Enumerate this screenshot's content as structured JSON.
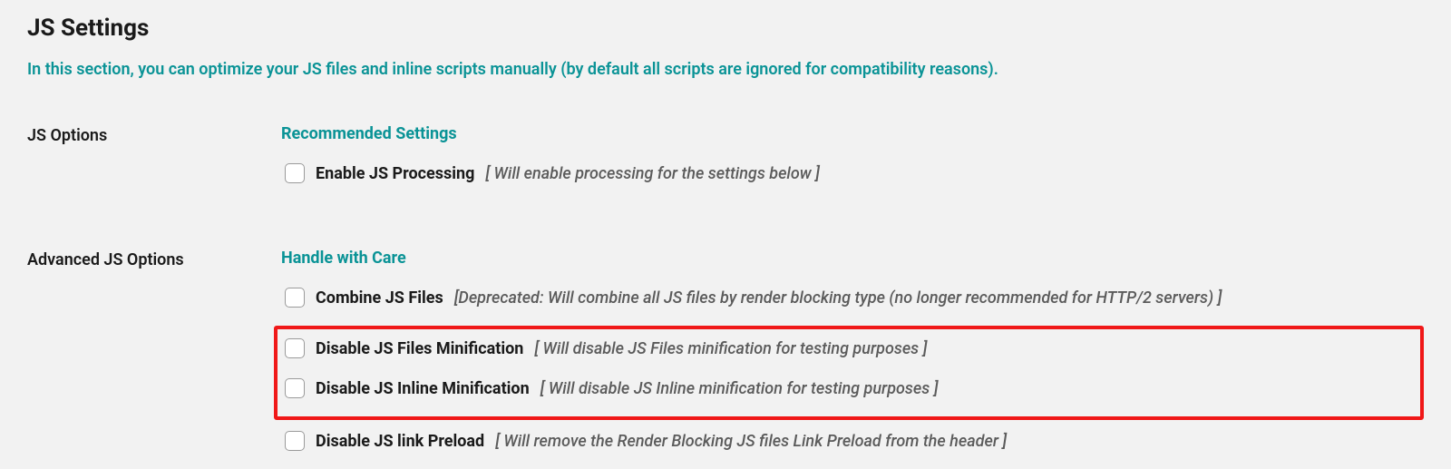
{
  "title": "JS Settings",
  "description": "In this section, you can optimize your JS files and inline scripts manually (by default all scripts are ignored for compatibility reasons).",
  "sections": [
    {
      "label": "JS Options",
      "subtitle": "Recommended Settings",
      "options": [
        {
          "label": "Enable JS Processing",
          "hint": "[ Will enable processing for the settings below ]"
        }
      ]
    },
    {
      "label": "Advanced JS Options",
      "subtitle": "Handle with Care",
      "options": [
        {
          "label": "Combine JS Files",
          "hint": "[Deprecated: Will combine all JS files by render blocking type (no longer recommended for HTTP/2 servers) ]"
        },
        {
          "label": "Disable JS Files Minification",
          "hint": "[ Will disable JS Files minification for testing purposes ]"
        },
        {
          "label": "Disable JS Inline Minification",
          "hint": "[ Will disable JS Inline minification for testing purposes ]"
        },
        {
          "label": "Disable JS link Preload",
          "hint": "[ Will remove the Render Blocking JS files Link Preload from the header ]"
        }
      ]
    }
  ]
}
